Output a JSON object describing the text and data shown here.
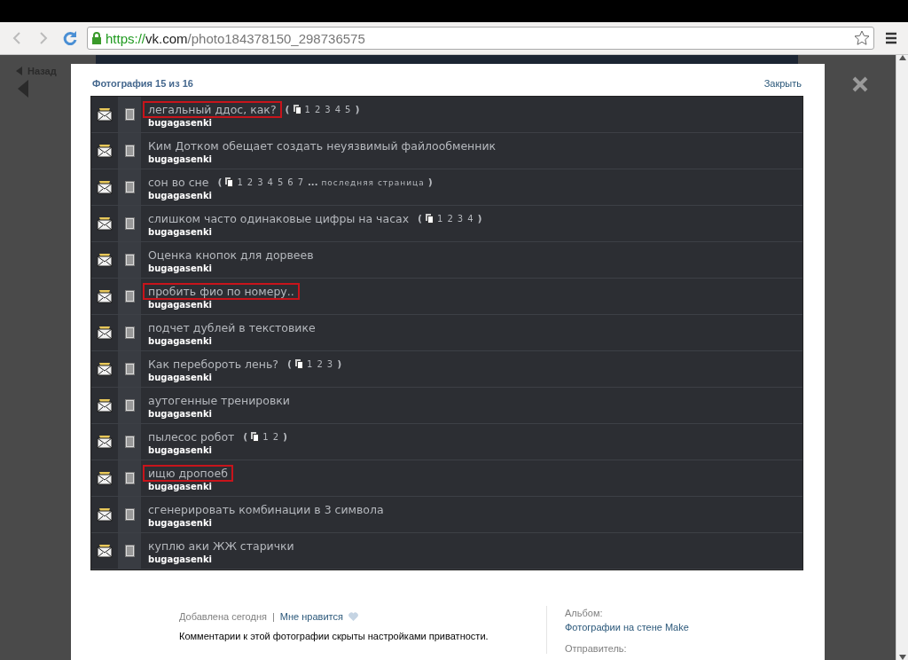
{
  "browser": {
    "url_scheme": "https://",
    "url_host": "vk.com",
    "url_path": "/photo184378150_298736575"
  },
  "nav": {
    "back": "Назад"
  },
  "viewer": {
    "counter": "Фотография 15 из 16",
    "close": "Закрыть"
  },
  "topics": [
    {
      "title": "легальный ддос, как?",
      "highlighted": true,
      "author": "bugagasenki",
      "pages": {
        "open": "(",
        "numbers": [
          "1",
          "2",
          "3",
          "4",
          "5"
        ],
        "close": ")"
      }
    },
    {
      "title": "Ким Дотком обещает создать неуязвимый файлообменник",
      "highlighted": false,
      "author": "bugagasenki"
    },
    {
      "title": "сон во сне",
      "highlighted": false,
      "author": "bugagasenki",
      "pages": {
        "open": "(",
        "numbers": [
          "1",
          "2",
          "3",
          "4",
          "5",
          "6",
          "7"
        ],
        "more": "...",
        "last": "последняя страница",
        "close": ")"
      }
    },
    {
      "title": "слишком часто одинаковые цифры на часах",
      "highlighted": false,
      "author": "bugagasenki",
      "pages": {
        "open": "(",
        "numbers": [
          "1",
          "2",
          "3",
          "4"
        ],
        "close": ")"
      }
    },
    {
      "title": "Оценка кнопок для дорвеев",
      "highlighted": false,
      "author": "bugagasenki"
    },
    {
      "title": "пробить фио по номеру..",
      "highlighted": true,
      "author": "bugagasenki"
    },
    {
      "title": "подчет дублей в текстовике",
      "highlighted": false,
      "author": "bugagasenki"
    },
    {
      "title": "Как перебороть лень?",
      "highlighted": false,
      "author": "bugagasenki",
      "pages": {
        "open": "(",
        "numbers": [
          "1",
          "2",
          "3"
        ],
        "close": ")"
      }
    },
    {
      "title": "аутогенные тренировки",
      "highlighted": false,
      "author": "bugagasenki"
    },
    {
      "title": "пылесос робот",
      "highlighted": false,
      "author": "bugagasenki",
      "pages": {
        "open": "(",
        "numbers": [
          "1",
          "2"
        ],
        "close": ")"
      }
    },
    {
      "title": "ищю дропоеб",
      "highlighted": true,
      "author": "bugagasenki"
    },
    {
      "title": "сгенерировать комбинации в 3 символа",
      "highlighted": false,
      "author": "bugagasenki"
    },
    {
      "title": "куплю аки ЖЖ старички",
      "highlighted": false,
      "author": "bugagasenki"
    }
  ],
  "footer": {
    "added": "Добавлена сегодня",
    "separator": "|",
    "like": "Мне нравится",
    "privacy_note": "Комментарии к этой фотографии скрыты настройками приватности.",
    "album_label": "Альбом:",
    "album_link": "Фотографии на стене Make",
    "sender_label": "Отправитель:"
  }
}
